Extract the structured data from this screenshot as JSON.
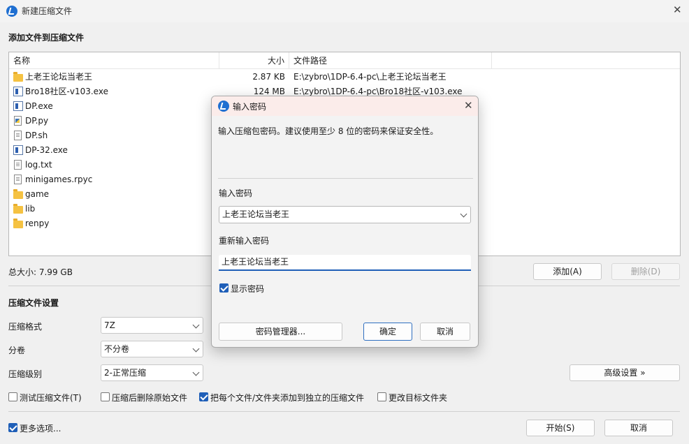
{
  "window": {
    "title": "新建压缩文件",
    "close_glyph": "✕"
  },
  "add_section": {
    "title": "添加文件到压缩文件"
  },
  "file_list": {
    "columns": [
      "名称",
      "大小",
      "文件路径"
    ],
    "rows": [
      {
        "icon": "folder-icon",
        "name": "上老王论坛当老王",
        "size": "2.87 KB",
        "path": "E:\\zybro\\1DP-6.4-pc\\上老王论坛当老王"
      },
      {
        "icon": "exe-icon",
        "name": "Bro18社区-v103.exe",
        "size": "124 MB",
        "path": "E:\\zybro\\1DP-6.4-pc\\Bro18社区-v103.exe"
      },
      {
        "icon": "exe-icon",
        "name": "DP.exe",
        "size": "",
        "path": ""
      },
      {
        "icon": "python-file-icon",
        "name": "DP.py",
        "size": "",
        "path": ""
      },
      {
        "icon": "script-file-icon",
        "name": "DP.sh",
        "size": "",
        "path": ""
      },
      {
        "icon": "exe-icon",
        "name": "DP-32.exe",
        "size": "",
        "path": ""
      },
      {
        "icon": "text-file-icon",
        "name": "log.txt",
        "size": "",
        "path": ""
      },
      {
        "icon": "file-icon",
        "name": "minigames.rpyc",
        "size": "",
        "path": ""
      },
      {
        "icon": "folder-icon",
        "name": "game",
        "size": "",
        "path": ""
      },
      {
        "icon": "folder-icon",
        "name": "lib",
        "size": "",
        "path": ""
      },
      {
        "icon": "folder-icon",
        "name": "renpy",
        "size": "",
        "path": ""
      }
    ]
  },
  "total_size": "总大小: 7.99 GB",
  "buttons": {
    "add": "添加(A)",
    "remove": "删除(D)",
    "advanced": "高级设置 »",
    "start": "开始(S)",
    "cancel": "取消"
  },
  "settings": {
    "title": "压缩文件设置",
    "format_label": "压缩格式",
    "format_value": "7Z",
    "split_label": "分卷",
    "split_value": "不分卷",
    "level_label": "压缩级别",
    "level_value": "2-正常压缩"
  },
  "options": {
    "test_archive": {
      "label": "测试压缩文件(T)",
      "checked": false
    },
    "delete_source": {
      "label": "压缩后删除原始文件",
      "checked": false
    },
    "separate_archives": {
      "label": "把每个文件/文件夹添加到独立的压缩文件",
      "checked": true
    },
    "change_target": {
      "label": "更改目标文件夹",
      "checked": false
    },
    "more_options": {
      "label": "更多选项...",
      "checked": true
    }
  },
  "password_dialog": {
    "title": "输入密码",
    "close_glyph": "✕",
    "description": "输入压缩包密码。建议使用至少 8 位的密码来保证安全性。",
    "password_label": "输入密码",
    "password_value": "上老王论坛当老王",
    "confirm_label": "重新输入密码",
    "confirm_value": "上老王论坛当老王",
    "show_password": {
      "label": "显示密码",
      "checked": true
    },
    "manager_button": "密码管理器...",
    "ok_button": "确定",
    "cancel_button": "取消"
  }
}
